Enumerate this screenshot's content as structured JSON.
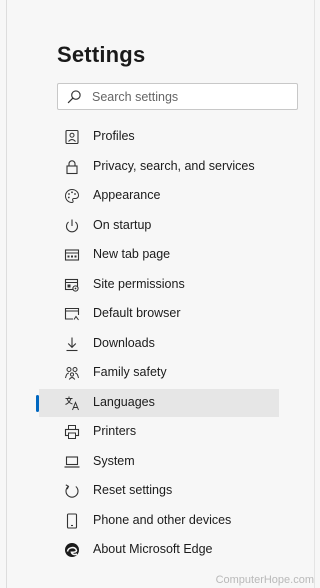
{
  "title": "Settings",
  "search": {
    "placeholder": "Search settings"
  },
  "nav": [
    {
      "label": "Profiles",
      "icon": "profile-icon"
    },
    {
      "label": "Privacy, search, and services",
      "icon": "lock-icon"
    },
    {
      "label": "Appearance",
      "icon": "palette-icon"
    },
    {
      "label": "On startup",
      "icon": "power-icon"
    },
    {
      "label": "New tab page",
      "icon": "new-tab-icon"
    },
    {
      "label": "Site permissions",
      "icon": "site-permissions-icon"
    },
    {
      "label": "Default browser",
      "icon": "browser-icon"
    },
    {
      "label": "Downloads",
      "icon": "download-icon"
    },
    {
      "label": "Family safety",
      "icon": "family-icon"
    },
    {
      "label": "Languages",
      "icon": "language-icon",
      "selected": true
    },
    {
      "label": "Printers",
      "icon": "printer-icon"
    },
    {
      "label": "System",
      "icon": "laptop-icon"
    },
    {
      "label": "Reset settings",
      "icon": "reset-icon"
    },
    {
      "label": "Phone and other devices",
      "icon": "phone-icon"
    },
    {
      "label": "About Microsoft Edge",
      "icon": "edge-icon"
    }
  ],
  "watermark": "ComputerHope.com",
  "colors": {
    "accent": "#0067c0",
    "selected_bg": "#e6e6e6",
    "background": "#f7f7f7"
  }
}
